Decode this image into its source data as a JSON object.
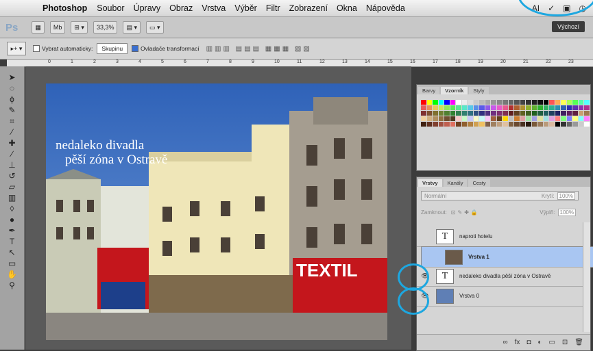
{
  "menubar": {
    "apple_icon": "apple-icon",
    "app_name": "Photoshop",
    "items": [
      "Soubor",
      "Úpravy",
      "Obraz",
      "Vrstva",
      "Výběr",
      "Filtr",
      "Zobrazení",
      "Okna",
      "Nápověda"
    ]
  },
  "appbar": {
    "logo": "Ps",
    "zoom": "33,3%",
    "workspace": "Výchozí"
  },
  "options": {
    "auto_select_label": "Vybrat automaticky:",
    "auto_select_value": "Skupinu",
    "transform_label": "Ovladače transformací"
  },
  "ruler_ticks": [
    "0",
    "1",
    "2",
    "3",
    "4",
    "5",
    "6",
    "7",
    "8",
    "9",
    "10",
    "11",
    "12",
    "13",
    "14",
    "15",
    "16",
    "17",
    "18",
    "19",
    "20",
    "21",
    "22",
    "23"
  ],
  "canvas": {
    "line1": "nedaleko divadla",
    "line2": "pěší zóna v Ostravě",
    "shop_sign": "TEXTIL"
  },
  "swatch_panel": {
    "tabs": [
      "Barvy",
      "Vzorník",
      "Styly"
    ],
    "active_tab": "Vzorník"
  },
  "layers_panel": {
    "tabs": [
      "Vrstvy",
      "Kanály",
      "Cesty"
    ],
    "active_tab": "Vrstvy",
    "blend_mode": "Normální",
    "opacity_label": "Krytí:",
    "opacity_value": "100%",
    "lock_label": "Zamknout:",
    "fill_label": "Výplň:",
    "fill_value": "100%",
    "layers": [
      {
        "name": "naproti hotelu",
        "type": "text",
        "visible": false,
        "selected": false
      },
      {
        "name": "Vrstva 1",
        "type": "image",
        "visible": false,
        "selected": true
      },
      {
        "name": "nedaleko divadla  pěší zóna v Ostravě",
        "type": "text",
        "visible": true,
        "selected": false
      },
      {
        "name": "Vrstva 0",
        "type": "image",
        "visible": true,
        "selected": false
      }
    ]
  },
  "colors": {
    "highlight_circle": "#1da7e0",
    "selected_layer": "#a9c6f2",
    "sign_red": "#c4161c"
  }
}
